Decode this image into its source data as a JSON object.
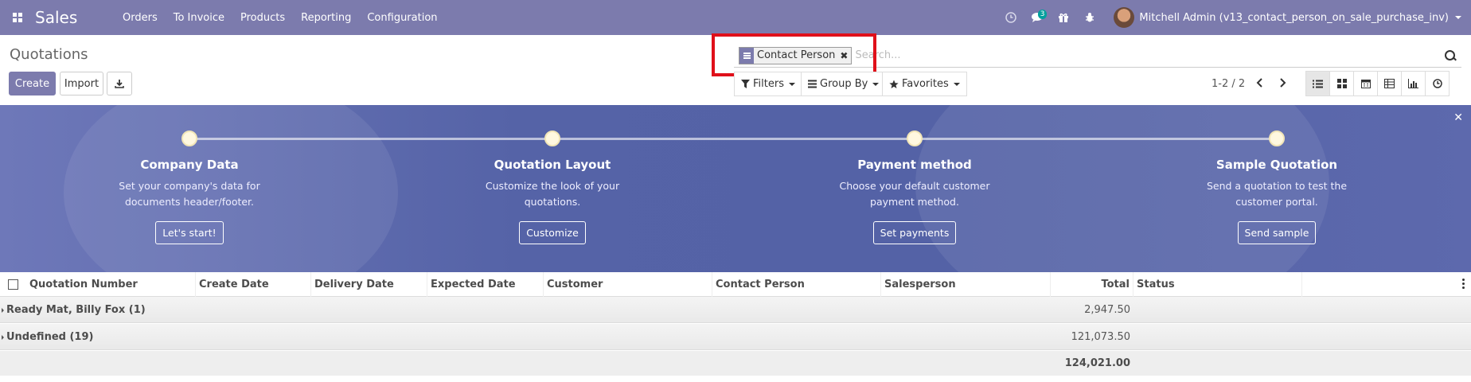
{
  "navbar": {
    "app_name": "Sales",
    "menu": [
      "Orders",
      "To Invoice",
      "Products",
      "Reporting",
      "Configuration"
    ],
    "chat_badge": "3",
    "user": "Mitchell Admin (v13_contact_person_on_sale_purchase_inv)"
  },
  "control_panel": {
    "breadcrumb": "Quotations",
    "create_label": "Create",
    "import_label": "Import",
    "search": {
      "facet_label": "Contact Person",
      "placeholder": "Search..."
    },
    "filters_label": "Filters",
    "groupby_label": "Group By",
    "favorites_label": "Favorites",
    "pager": "1-2 / 2"
  },
  "banner": {
    "steps": [
      {
        "title": "Company Data",
        "desc": "Set your company's data for documents header/footer.",
        "button": "Let's start!"
      },
      {
        "title": "Quotation Layout",
        "desc": "Customize the look of your quotations.",
        "button": "Customize"
      },
      {
        "title": "Payment method",
        "desc": "Choose your default customer payment method.",
        "button": "Set payments"
      },
      {
        "title": "Sample Quotation",
        "desc": "Send a quotation to test the customer portal.",
        "button": "Send sample"
      }
    ]
  },
  "list": {
    "columns": [
      "Quotation Number",
      "Create Date",
      "Delivery Date",
      "Expected Date",
      "Customer",
      "Contact Person",
      "Salesperson",
      "Total",
      "Status"
    ],
    "groups": [
      {
        "label": "Ready Mat, Billy Fox (1)",
        "total": "2,947.50"
      },
      {
        "label": "Undefined (19)",
        "total": "121,073.50"
      }
    ],
    "grand_total": "124,021.00"
  },
  "colors": {
    "brand": "#7c7bad",
    "highlight": "#e0101a",
    "badge": "#00a09d"
  }
}
